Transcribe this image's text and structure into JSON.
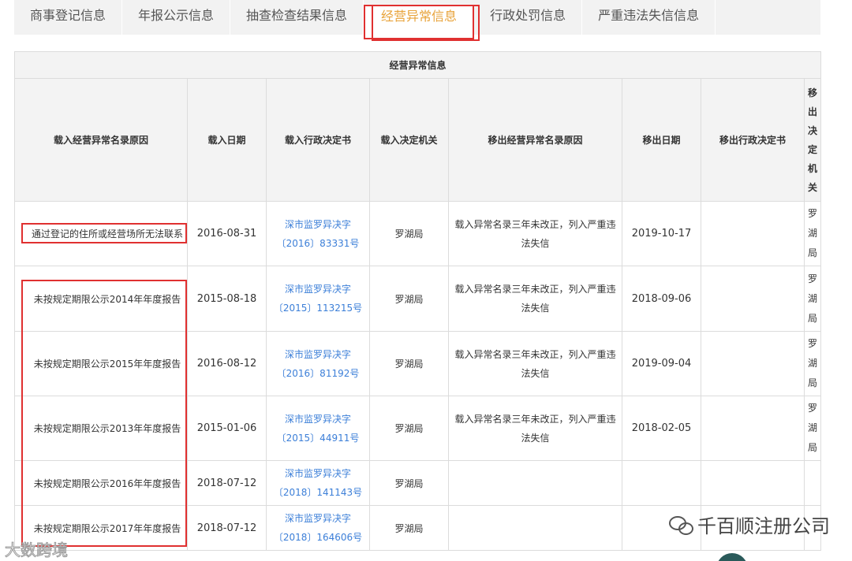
{
  "tabs": [
    {
      "label": "商事登记信息"
    },
    {
      "label": "年报公示信息"
    },
    {
      "label": "抽查检查结果信息"
    },
    {
      "label": "经营异常信息"
    },
    {
      "label": "行政处罚信息"
    },
    {
      "label": "严重违法失信信息"
    }
  ],
  "table": {
    "caption": "经营异常信息",
    "headers": [
      "载入经营异常名录原因",
      "载入日期",
      "载入行政决定书",
      "载入决定机关",
      "移出经营异常名录原因",
      "移出日期",
      "移出行政决定书",
      "移出决定机关"
    ],
    "header_vertical_last": [
      "移",
      "出",
      "决",
      "定",
      "机",
      "关"
    ],
    "rows": [
      {
        "reason": "通过登记的住所或经营场所无法联系",
        "date": "2016-08-31",
        "doc_line1": "深市监罗异决字",
        "doc_line2": "〔2016〕83331号",
        "org": "罗湖局",
        "remove_line1": "载入异常名录三年未改正，列入严重违",
        "remove_line2": "法失信",
        "remove_date": "2019-10-17",
        "remove_doc": "",
        "remove_org": [
          "罗",
          "湖",
          "局"
        ]
      },
      {
        "reason": "未按规定期限公示2014年年度报告",
        "date": "2015-08-18",
        "doc_line1": "深市监罗异决字",
        "doc_line2": "〔2015〕113215号",
        "org": "罗湖局",
        "remove_line1": "载入异常名录三年未改正，列入严重违",
        "remove_line2": "法失信",
        "remove_date": "2018-09-06",
        "remove_doc": "",
        "remove_org": [
          "罗",
          "湖",
          "局"
        ]
      },
      {
        "reason": "未按规定期限公示2015年年度报告",
        "date": "2016-08-12",
        "doc_line1": "深市监罗异决字",
        "doc_line2": "〔2016〕81192号",
        "org": "罗湖局",
        "remove_line1": "载入异常名录三年未改正，列入严重违",
        "remove_line2": "法失信",
        "remove_date": "2019-09-04",
        "remove_doc": "",
        "remove_org": [
          "罗",
          "湖",
          "局"
        ]
      },
      {
        "reason": "未按规定期限公示2013年年度报告",
        "date": "2015-01-06",
        "doc_line1": "深市监罗异决字",
        "doc_line2": "〔2015〕44911号",
        "org": "罗湖局",
        "remove_line1": "载入异常名录三年未改正，列入严重违",
        "remove_line2": "法失信",
        "remove_date": "2018-02-05",
        "remove_doc": "",
        "remove_org": [
          "罗",
          "湖",
          "局"
        ]
      },
      {
        "reason": "未按规定期限公示2016年年度报告",
        "date": "2018-07-12",
        "doc_line1": "深市监罗异决字",
        "doc_line2": "〔2018〕141143号",
        "org": "罗湖局",
        "remove_line1": "",
        "remove_line2": "",
        "remove_date": "",
        "remove_doc": "",
        "remove_org": [
          "",
          "",
          ""
        ]
      },
      {
        "reason": "未按规定期限公示2017年年度报告",
        "date": "2018-07-12",
        "doc_line1": "深市监罗异决字",
        "doc_line2": "〔2018〕164606号",
        "org": "罗湖局",
        "remove_line1": "",
        "remove_line2": "",
        "remove_date": "",
        "remove_doc": "",
        "remove_org": [
          "",
          "",
          ""
        ]
      }
    ]
  },
  "watermark": {
    "text": "千百顺注册公司",
    "bottom_left": "大数跨境"
  },
  "colors": {
    "highlight_border": "#e03030",
    "active_tab_text": "#e8a33a",
    "link": "#3c7fd8",
    "header_bg": "#f3f3f3"
  }
}
